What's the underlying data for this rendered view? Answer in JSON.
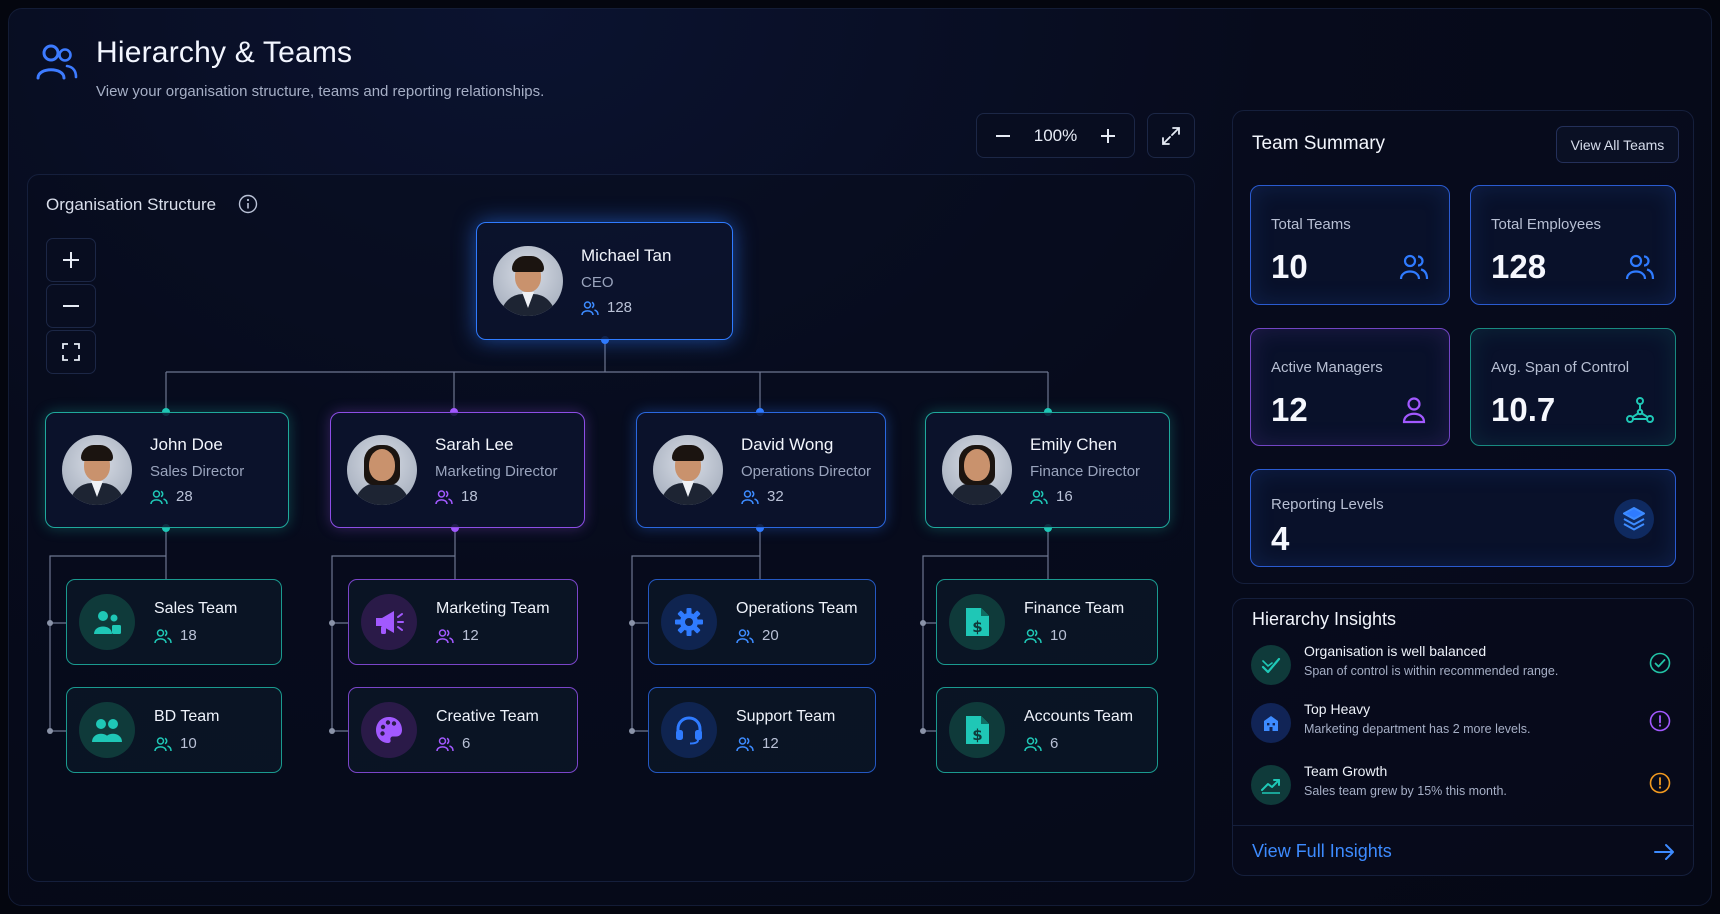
{
  "header": {
    "title": "Hierarchy & Teams",
    "subtitle": "View your organisation structure, teams and reporting relationships."
  },
  "zoom": {
    "level": "100%"
  },
  "org": {
    "title": "Organisation Structure",
    "ceo": {
      "name": "Michael Tan",
      "role": "CEO",
      "count": "128"
    },
    "directors": [
      {
        "name": "John Doe",
        "role": "Sales Director",
        "count": "28",
        "accent": "#1fc7b6"
      },
      {
        "name": "Sarah Lee",
        "role": "Marketing Director",
        "count": "18",
        "accent": "#a259ff"
      },
      {
        "name": "David Wong",
        "role": "Operations Director",
        "count": "32",
        "accent": "#2f7bff"
      },
      {
        "name": "Emily Chen",
        "role": "Finance Director",
        "count": "16",
        "accent": "#1fc7b6"
      }
    ],
    "teams": [
      {
        "name": "Sales Team",
        "count": "18",
        "icon": "user-group-icon"
      },
      {
        "name": "BD Team",
        "count": "10",
        "icon": "users-icon"
      },
      {
        "name": "Marketing Team",
        "count": "12",
        "icon": "megaphone-icon"
      },
      {
        "name": "Creative Team",
        "count": "6",
        "icon": "palette-icon"
      },
      {
        "name": "Operations Team",
        "count": "20",
        "icon": "gear-icon"
      },
      {
        "name": "Support Team",
        "count": "12",
        "icon": "headset-icon"
      },
      {
        "name": "Finance Team",
        "count": "10",
        "icon": "dollar-document-icon"
      },
      {
        "name": "Accounts Team",
        "count": "6",
        "icon": "dollar-document-icon"
      }
    ]
  },
  "summary": {
    "title": "Team Summary",
    "view_all_label": "View All Teams",
    "stats": [
      {
        "label": "Total Teams",
        "value": "10",
        "icon": "users-icon"
      },
      {
        "label": "Total Employees",
        "value": "128",
        "icon": "users-icon"
      },
      {
        "label": "Active Managers",
        "value": "12",
        "icon": "user-icon"
      },
      {
        "label": "Avg. Span of Control",
        "value": "10.7",
        "icon": "network-icon"
      },
      {
        "label": "Reporting Levels",
        "value": "4",
        "icon": "layers-icon"
      }
    ]
  },
  "insights": {
    "title": "Hierarchy Insights",
    "items": [
      {
        "title": "Organisation is well balanced",
        "desc": "Span of control is within recommended range.",
        "status": "check-circle-icon",
        "color": "#22c3a6"
      },
      {
        "title": "Top Heavy",
        "desc": "Marketing department has 2 more levels.",
        "status": "alert-circle-icon",
        "color": "#a259ff"
      },
      {
        "title": "Team Growth",
        "desc": "Sales team grew by 15% this month.",
        "status": "alert-circle-icon",
        "color": "#f29a1f"
      }
    ],
    "view_full_label": "View Full Insights"
  },
  "colors": {
    "background": "#050815",
    "teal": "#1fc7b6",
    "purple": "#a259ff",
    "blue": "#2f7bff",
    "link": "#3d8bff"
  }
}
